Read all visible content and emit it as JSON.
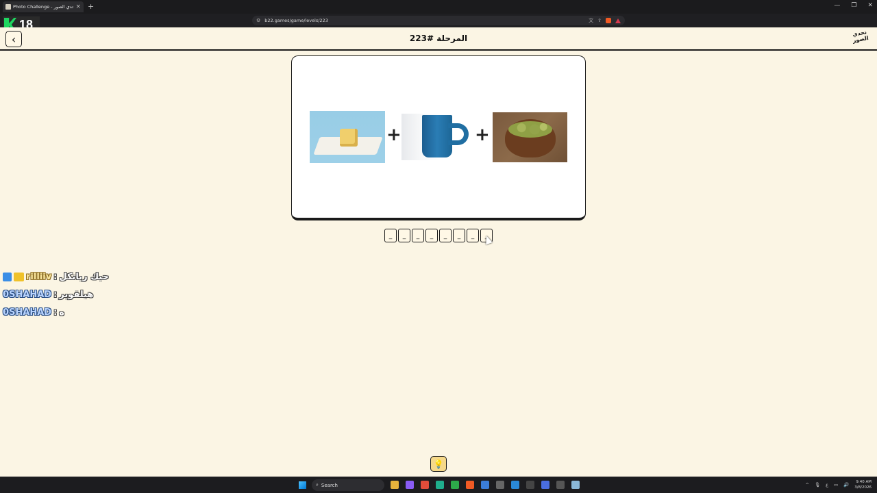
{
  "browser": {
    "tab_title": "Photo Challenge - تحدي الصور",
    "url": "b22.games/game/levels/223",
    "colors": {
      "chrome": "#1b1b1d",
      "brave_shield": "#f15a24"
    }
  },
  "overlay": {
    "badge_count": "18"
  },
  "header": {
    "level_title": "المرحلة #223",
    "logo_text": "تحدي الصور"
  },
  "puzzle": {
    "images": [
      "butter-image",
      "cup-image",
      "cardamom-image"
    ],
    "plus_symbol": "+",
    "slots": [
      "_",
      "_",
      "_",
      "_",
      "_",
      "_",
      "_",
      "_"
    ]
  },
  "chat": {
    "lines": [
      {
        "user": "rilliiv",
        "message": "حبك ربانكل"
      },
      {
        "user": "0SHAHAD",
        "message": "هيلقوبر"
      },
      {
        "user": "0SHAHAD",
        "message": "ه"
      }
    ]
  },
  "taskbar": {
    "search_label": "Search",
    "time": "9:40 AM",
    "date": "3/8/2026"
  }
}
